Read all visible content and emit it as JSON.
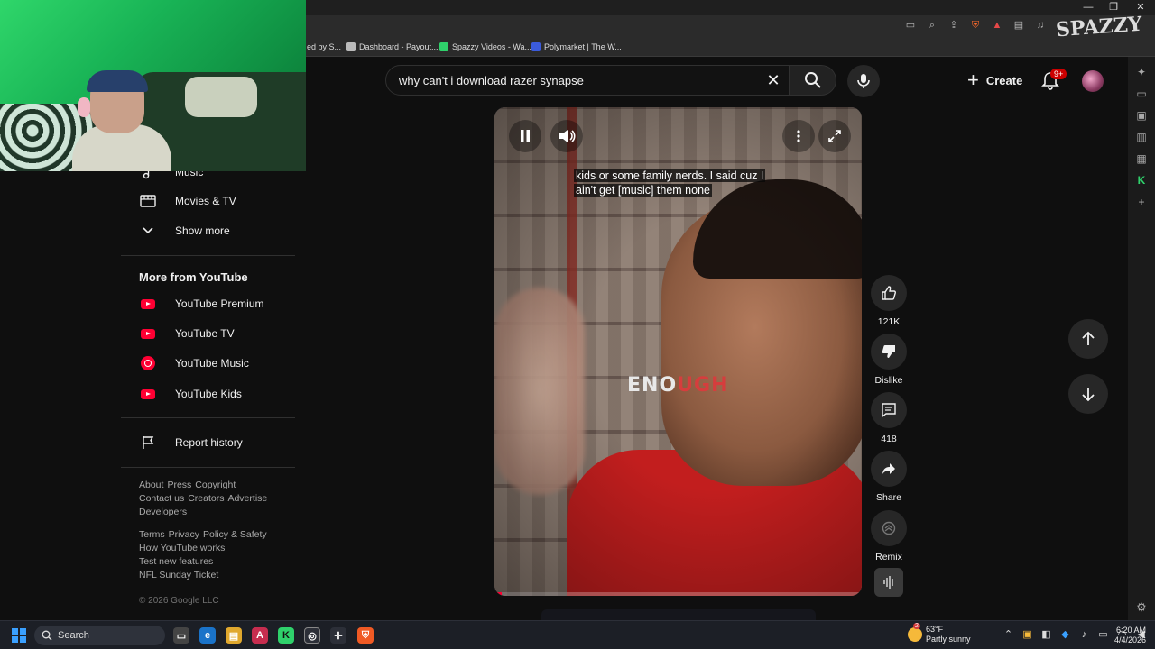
{
  "browser": {
    "bookmarks": [
      {
        "label": "ed by S...",
        "color": "#888888"
      },
      {
        "label": "Dashboard - Payout...",
        "color": "#bbbbbb"
      },
      {
        "label": "Spazzy Videos - Wa...",
        "color": "#2fd16b"
      },
      {
        "label": "Polymarket | The W...",
        "color": "#3b5bdb"
      }
    ]
  },
  "watermark": "SPAZZY",
  "header": {
    "search_query": "why can't i download razer synapse",
    "create_label": "Create",
    "notification_count": "9+"
  },
  "sidebar": {
    "music_label": "Music",
    "movies_label": "Movies & TV",
    "show_more_label": "Show more",
    "more_from_heading": "More from YouTube",
    "more_items": [
      "YouTube Premium",
      "YouTube TV",
      "YouTube Music",
      "YouTube Kids"
    ],
    "report_history_label": "Report history",
    "footer_row1": [
      "About",
      "Press",
      "Copyright"
    ],
    "footer_row2": [
      "Contact us",
      "Creators",
      "Advertise"
    ],
    "footer_row3": [
      "Developers"
    ],
    "footer_row4": [
      "Terms",
      "Privacy",
      "Policy & Safety"
    ],
    "footer_row5": [
      "How YouTube works"
    ],
    "footer_row6": [
      "Test new features"
    ],
    "footer_row7": [
      "NFL Sunday Ticket"
    ],
    "copyright": "© 2026 Google LLC"
  },
  "player": {
    "caption_line1": "kids or some family nerds. I said cuz I",
    "caption_line2": "ain't get [music] them none",
    "overlay_white": "ENO",
    "overlay_red": "UGH",
    "progress": 0.02
  },
  "actions": {
    "like_count": "121K",
    "dislike_label": "Dislike",
    "comment_count": "418",
    "share_label": "Share",
    "remix_label": "Remix"
  },
  "taskbar": {
    "search_label": "Search",
    "weather_temp": "63°F",
    "weather_desc": "Partly sunny",
    "weather_badge": "2",
    "time": "6:20 AM",
    "date": "4/4/2026"
  },
  "colors": {
    "youtube_red": "#ff0033",
    "background": "#0f0f0f",
    "chip": "#272727"
  }
}
